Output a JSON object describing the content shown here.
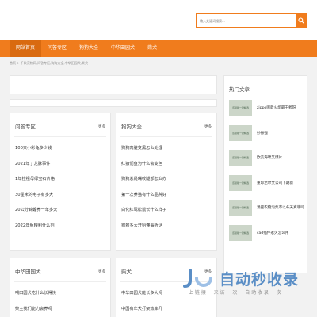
{
  "search": {
    "placeholder": "输入关键词搜索..."
  },
  "nav": {
    "items": [
      "网站首页",
      "问答专区",
      "狗狗大全",
      "中华田园犬",
      "柴犬"
    ]
  },
  "breadcrumb": "首页 > 千秋宠物网,问答专区,狗狗大全,中华田园犬,柴犬",
  "hot_articles": {
    "title": "热门文章",
    "thumb_label": "该模版一张精选",
    "items": [
      "zippo哪款火焰最王者呀",
      "孙振强",
      "欧美海啸又爆片",
      "重印达尔文公司下期新",
      "涌露农物淘集市以冬天真菲吗",
      "cad插件永久怎么用"
    ]
  },
  "sections": {
    "qa": {
      "title": "问答专区",
      "more": "更多",
      "items": [
        "100只小彩龟多少钱",
        "2021年了龙脉事件",
        "1年拉祖母绿宝石价格",
        "30星米的电子有多大",
        "20公分锦鲤养一年多大",
        "2022年鱼粮利什么剂"
      ]
    },
    "dogs": {
      "title": "狗狗大全",
      "more": "更多",
      "items": [
        "狗狗肉脏变黑怎么处理",
        "红狼们鱼为什么会变色",
        "狗狗总是嘴咬腿部怎么办",
        "第一次养猫有什么品种好",
        "白化红鹭松鼠长什么样子",
        "狗狗多大开始懂事听话"
      ]
    },
    "tianyuan": {
      "title": "中华田园犬",
      "more": "更多",
      "items": [
        "喂田园犬吃什么长得快",
        "柴主我们能力会养吗"
      ]
    },
    "shiba": {
      "title": "柴犬",
      "more": "更多",
      "items": [
        "中华田园犬能长多大吗",
        "中国有年犬打架效率几"
      ]
    }
  },
  "watermark": {
    "main": "自动秒收录",
    "sub": "上 链 接 一 来 访 一 次 一 自 动 收 录 一 次"
  },
  "colors": {
    "accent": "#f07c1d",
    "nav_active": "#d96a10",
    "background": "#f2f2f2"
  }
}
